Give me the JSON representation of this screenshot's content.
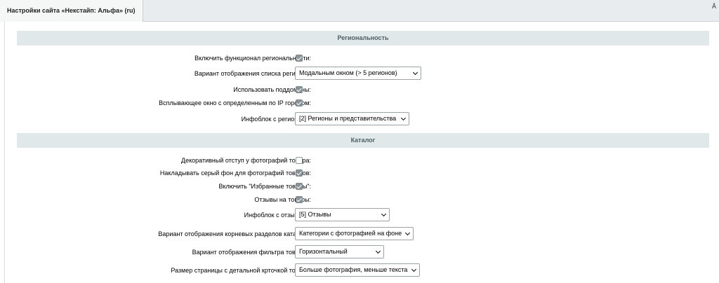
{
  "tab": {
    "title": "Настройки сайта «Некстайп: Альфа» (ru)"
  },
  "corner_mark": "Ā",
  "sections": {
    "regional": {
      "title": "Региональность",
      "rows": [
        {
          "label": "Включить функционал региональности:",
          "checked": true
        },
        {
          "label": "Вариант отображения списка регионов:",
          "select": "Модальным окном (> 5 регионов)"
        },
        {
          "label": "Использовать поддомены:",
          "checked": true
        },
        {
          "label": "Всплывающее окно с определенным по IP городом:",
          "checked": true
        },
        {
          "label": "Инфоблок с регионами:",
          "select": "[2] Регионы и представительства"
        }
      ]
    },
    "catalog": {
      "title": "Каталог",
      "rows": [
        {
          "label": "Декоративный отступ у фотографий товара:",
          "checked": false
        },
        {
          "label": "Накладывать серый фон для фотографий товаров:",
          "checked": true
        },
        {
          "label": "Включить \"Избранные товары\":",
          "checked": true
        },
        {
          "label": "Отзывы на товары:",
          "checked": true
        },
        {
          "label": "Инфоблок с отзывами:",
          "select": "[5] Отзывы"
        },
        {
          "label": "Вариант отображения корневых разделов каталога:",
          "select": "Категории с фотографией на фоне"
        },
        {
          "label": "Вариант отображения фильтра товаров:",
          "select": "Горизонтальный"
        },
        {
          "label": "Размер страницы с детальной крточкой товара:",
          "select": "Больше фотография, меньше текста"
        }
      ]
    }
  }
}
